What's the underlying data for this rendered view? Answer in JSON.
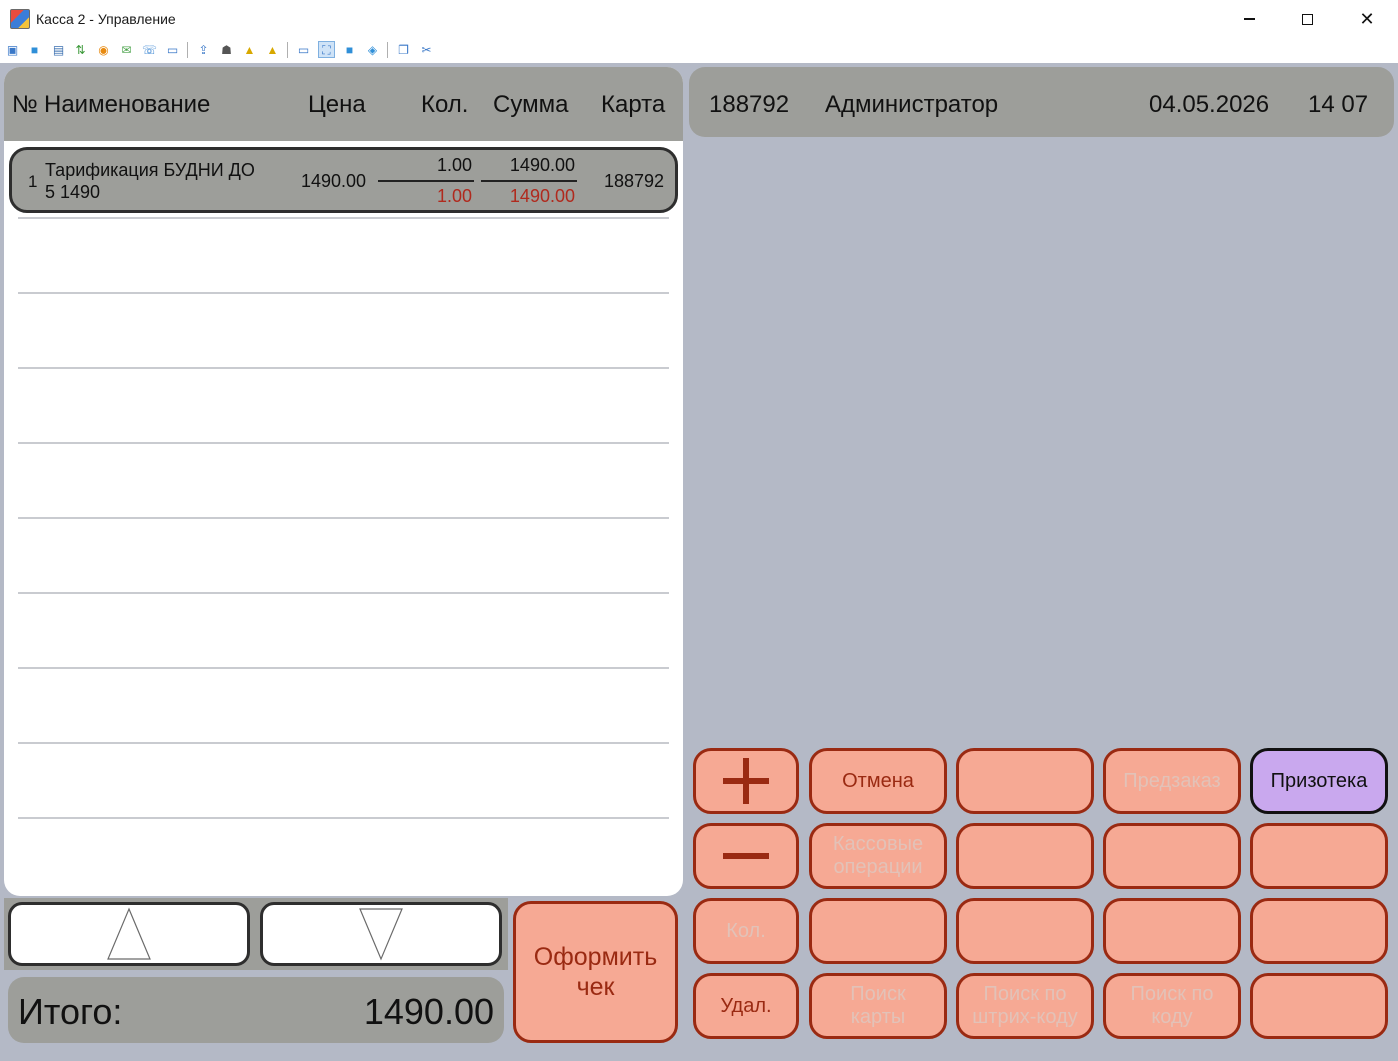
{
  "window": {
    "title": "Касса 2 - Управление"
  },
  "order": {
    "headers": {
      "num": "№",
      "name": "Наименование",
      "price": "Цена",
      "qty": "Кол.",
      "sum": "Сумма",
      "card": "Карта"
    },
    "rows": [
      {
        "num": "1",
        "name": "Тарификация БУДНИ ДО 5 1490",
        "price": "1490.00",
        "qty_top": "1.00",
        "qty_bottom": "1.00",
        "sum_top": "1490.00",
        "sum_bottom": "1490.00",
        "card": "188792"
      }
    ]
  },
  "total": {
    "label": "Итого:",
    "value": "1490.00"
  },
  "checkout": {
    "label": "Оформить чек"
  },
  "info": {
    "card": "188792",
    "user": "Администратор",
    "date": "04.05.2026",
    "time": "14 07"
  },
  "keys": {
    "cancel": "Отмена",
    "preorder": "Предзаказ",
    "prize": "Призотека",
    "cash_ops": "Кассовые операции",
    "qty": "Кол.",
    "delete": "Удал.",
    "find_card": "Поиск карты",
    "find_barcode": "Поиск по штрих-коду",
    "find_code": "Поиск по коду"
  },
  "colors": {
    "panel_gray": "#9d9e9a",
    "background": "#b4b9c6",
    "key_fill": "#f6a994",
    "key_border": "#9a2a12",
    "accent_red": "#b02a1e",
    "prize_fill": "#c9a8ee"
  }
}
